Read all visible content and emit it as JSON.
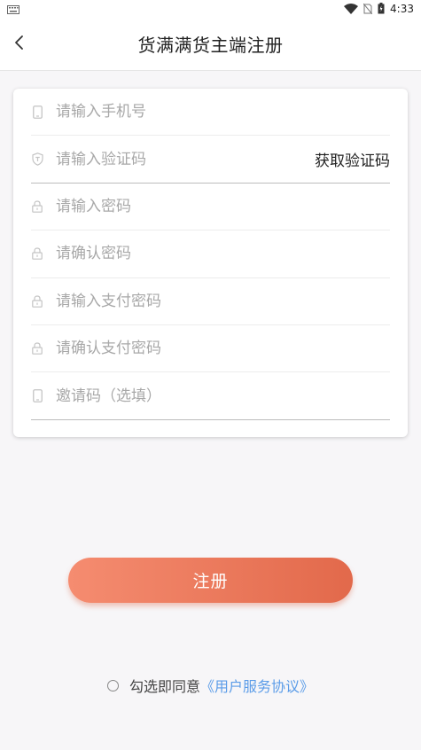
{
  "status_bar": {
    "time": "4:33"
  },
  "header": {
    "title": "货满满货主端注册"
  },
  "form": {
    "phone_placeholder": "请输入手机号",
    "code_placeholder": "请输入验证码",
    "get_code_label": "获取验证码",
    "password_placeholder": "请输入密码",
    "confirm_password_placeholder": "请确认密码",
    "pay_password_placeholder": "请输入支付密码",
    "confirm_pay_password_placeholder": "请确认支付密码",
    "invite_code_placeholder": "邀请码（选填）"
  },
  "register_label": "注册",
  "agreement": {
    "text": "勾选即同意",
    "link": "《用户服务协议》"
  },
  "colors": {
    "accent_start": "#f58c70",
    "accent_end": "#e2694b",
    "link": "#5b9ce8"
  }
}
